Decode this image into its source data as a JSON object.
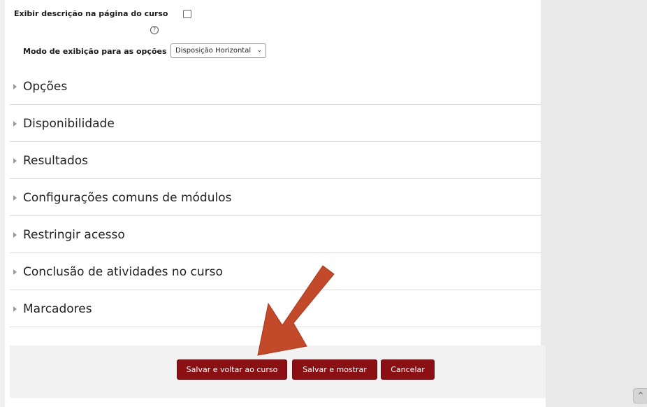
{
  "form": {
    "show_description_label": "Exibir descrição na página do curso",
    "help_icon": "?",
    "display_mode_label": "Modo de exibição para as opções",
    "display_mode_value": "Disposição Horizontal"
  },
  "sections": [
    {
      "label": "Opções"
    },
    {
      "label": "Disponibilidade"
    },
    {
      "label": "Resultados"
    },
    {
      "label": "Configurações comuns de módulos"
    },
    {
      "label": "Restringir acesso"
    },
    {
      "label": "Conclusão de atividades no curso"
    },
    {
      "label": "Marcadores"
    }
  ],
  "buttons": {
    "save_back": "Salvar e voltar ao curso",
    "save_show": "Salvar e mostrar",
    "cancel": "Cancelar"
  },
  "colors": {
    "button_bg": "#8b1014",
    "arrow": "#c24a2a"
  },
  "scroll_top_icon": "^"
}
